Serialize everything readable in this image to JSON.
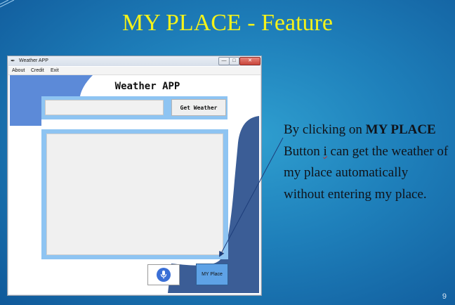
{
  "slide": {
    "title": "MY PLACE - Feature",
    "number": "9",
    "description": {
      "part1": "By clicking on ",
      "bold1": "MY PLACE",
      "part2": " Button ",
      "squiggle": "i",
      "part3": " can get the weather of my place automatically without entering my place."
    }
  },
  "window": {
    "title": "Weather APP",
    "menu": [
      "About",
      "Credit",
      "Exit"
    ],
    "controls": {
      "minimize": "—",
      "maximize": "□",
      "close": "✕"
    }
  },
  "app": {
    "title": "Weather APP",
    "city_input": {
      "value": "",
      "placeholder": ""
    },
    "get_weather_label": "Get Weather",
    "my_place_label": "MY Place",
    "mic_icon": "microphone-icon"
  },
  "colors": {
    "title_yellow": "#f4f21a",
    "frame_blue": "#8ec4f2",
    "dark_blue_shape": "#3b5d96",
    "mid_blue_shape": "#5c8ad8",
    "button_blue": "#5ea2e6",
    "mic_blue": "#3a6fd6"
  }
}
